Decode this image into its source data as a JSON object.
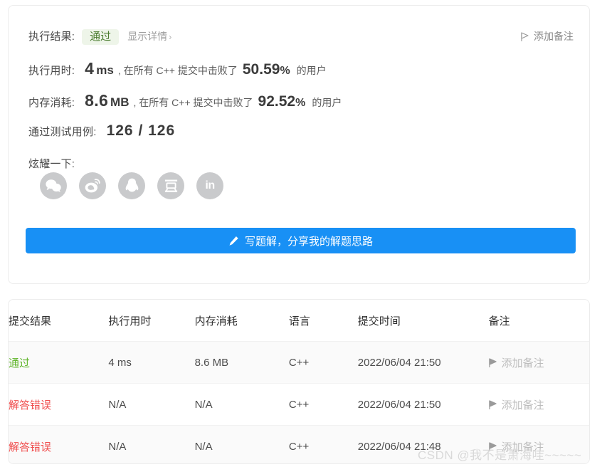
{
  "result_card": {
    "result": {
      "label": "执行结果:",
      "status": "通过",
      "detail_link": "显示详情",
      "chevron": "›"
    },
    "runtime": {
      "label": "执行用时:",
      "value": "4",
      "unit": "ms",
      "mid": ", 在所有 C++ 提交中击败了",
      "percent": "50.59",
      "percent_sign": "%",
      "tail": "的用户"
    },
    "memory": {
      "label": "内存消耗:",
      "value": "8.6",
      "unit": "MB",
      "mid": ", 在所有 C++ 提交中击败了",
      "percent": "92.52",
      "percent_sign": "%",
      "tail": "的用户"
    },
    "testcases": {
      "label": "通过测试用例:",
      "value": "126 / 126"
    },
    "share": {
      "label": "炫耀一下:",
      "icons": [
        {
          "name": "wechat-share-icon",
          "title": "微信"
        },
        {
          "name": "weibo-share-icon",
          "title": "微博"
        },
        {
          "name": "qq-share-icon",
          "title": "QQ"
        },
        {
          "name": "douban-share-icon",
          "title": "豆瓣"
        },
        {
          "name": "linkedin-share-icon",
          "title": "LinkedIn",
          "text": "in"
        }
      ]
    },
    "add_note": {
      "icon": "flag-icon",
      "label": "添加备注"
    },
    "write_solution": {
      "icon": "pencil-icon",
      "label": "写题解，分享我的解题思路"
    }
  },
  "submissions": {
    "columns": [
      "提交结果",
      "执行用时",
      "内存消耗",
      "语言",
      "提交时间",
      "备注"
    ],
    "rows": [
      {
        "status": "通过",
        "status_kind": "pass",
        "runtime": "4 ms",
        "memory": "8.6 MB",
        "language": "C++",
        "time": "2022/06/04 21:50",
        "note": "添加备注"
      },
      {
        "status": "解答错误",
        "status_kind": "wrong",
        "runtime": "N/A",
        "memory": "N/A",
        "language": "C++",
        "time": "2022/06/04 21:50",
        "note": "添加备注"
      },
      {
        "status": "解答错误",
        "status_kind": "wrong",
        "runtime": "N/A",
        "memory": "N/A",
        "language": "C++",
        "time": "2022/06/04 21:48",
        "note": "添加备注"
      }
    ]
  },
  "watermark": "CSDN @我不是萧海哇~~~~~",
  "colors": {
    "accent_blue": "#1890f5",
    "pass_green": "#5eb429",
    "wrong_red": "#f05050",
    "badge_bg": "#eef5e9",
    "badge_text": "#4a7c2f",
    "social_circle": "#c9cacc"
  }
}
